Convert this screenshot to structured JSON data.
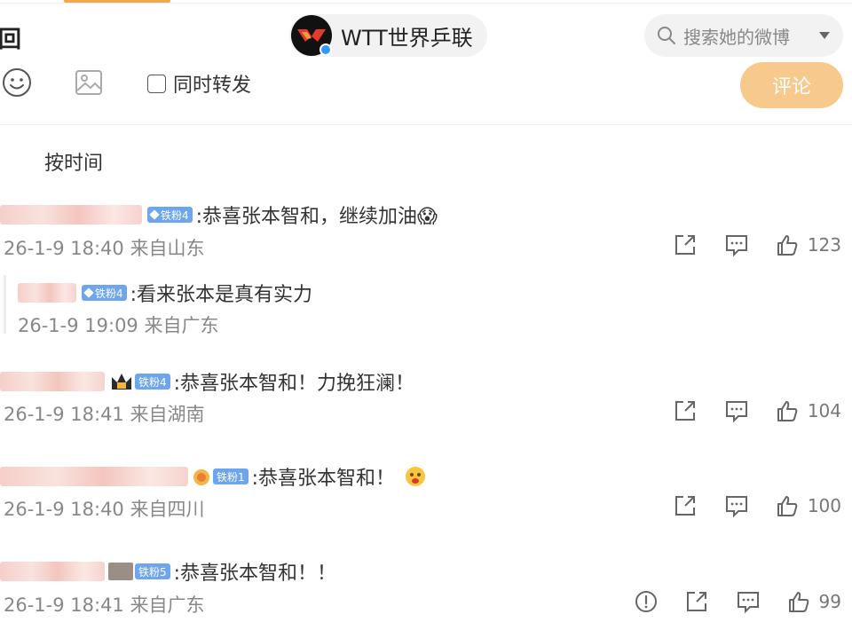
{
  "header": {
    "title_partial": "回",
    "account_name": "WTT世界乒联",
    "search_placeholder": "搜索她的微博"
  },
  "composer": {
    "repost_label": "同时转发",
    "comment_button": "评论"
  },
  "sort": {
    "label": "按时间"
  },
  "comments": [
    {
      "badge": "铁粉4",
      "text": ":恭喜张本智和，继续加油😱",
      "meta": "26-1-9 18:40 来自山东",
      "likes": "123",
      "reply": {
        "badge": "铁粉4",
        "text": ":看来张本是真有实力",
        "meta": "26-1-9 19:09 来自广东"
      }
    },
    {
      "badge": "铁粉4",
      "text": ":恭喜张本智和！力挽狂澜！",
      "meta": "26-1-9 18:41 来自湖南",
      "likes": "104"
    },
    {
      "badge": "铁粉1",
      "text": ":恭喜张本智和！",
      "meta": "26-1-9 18:40 来自四川",
      "likes": "100"
    },
    {
      "badge": "铁粉5",
      "text": ":恭喜张本智和！！",
      "meta": "26-1-9 18:41 来自广东",
      "likes": "99"
    }
  ],
  "colors": {
    "accent": "#f5a84a",
    "comment_button": "#f8c98c",
    "badge": "#6ea5ef",
    "meta_text": "#888888"
  }
}
